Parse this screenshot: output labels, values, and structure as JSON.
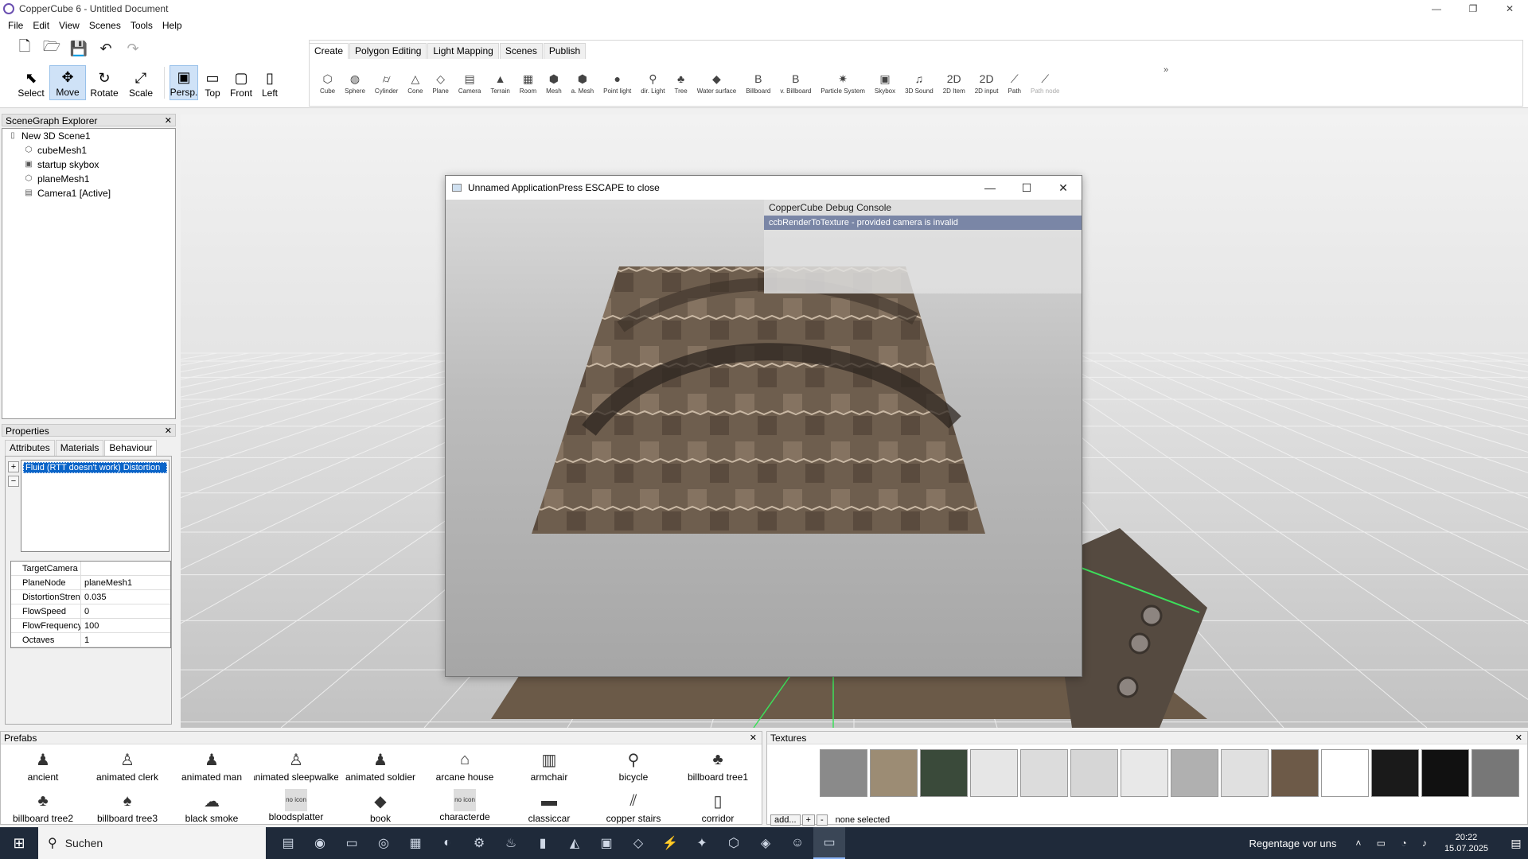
{
  "window": {
    "title": "CopperCube 6 - Untitled Document",
    "min": "—",
    "max": "❐",
    "close": "✕"
  },
  "menu": [
    "File",
    "Edit",
    "View",
    "Scenes",
    "Tools",
    "Help"
  ],
  "toolbar": {
    "file_icons": [
      "new-document-icon",
      "open-folder-icon",
      "save-icon",
      "undo-icon",
      "redo-icon"
    ],
    "tools": [
      {
        "label": "Select",
        "glyph": "⬉",
        "icon": "select-cursor-icon",
        "active": false
      },
      {
        "label": "Move",
        "glyph": "✥",
        "icon": "move-arrows-icon",
        "active": true
      },
      {
        "label": "Rotate",
        "glyph": "↻",
        "icon": "rotate-icon",
        "active": false
      },
      {
        "label": "Scale",
        "glyph": "⤢",
        "icon": "scale-icon",
        "active": false
      }
    ],
    "views": [
      {
        "label": "Persp.",
        "glyph": "▣",
        "icon": "perspective-view-icon",
        "active": true
      },
      {
        "label": "Top",
        "glyph": "▭",
        "icon": "top-view-icon",
        "active": false
      },
      {
        "label": "Front",
        "glyph": "▢",
        "icon": "front-view-icon",
        "active": false
      },
      {
        "label": "Left",
        "glyph": "▯",
        "icon": "left-view-icon",
        "active": false
      }
    ]
  },
  "tabs": [
    "Create",
    "Polygon Editing",
    "Light Mapping",
    "Scenes",
    "Publish"
  ],
  "create_items": [
    {
      "label": "Cube",
      "glyph": "⬡"
    },
    {
      "label": "Sphere",
      "glyph": "◍"
    },
    {
      "label": "Cylinder",
      "glyph": "⌭"
    },
    {
      "label": "Cone",
      "glyph": "△"
    },
    {
      "label": "Plane",
      "glyph": "◇"
    },
    {
      "label": "Camera",
      "glyph": "▤"
    },
    {
      "label": "Terrain",
      "glyph": "▲"
    },
    {
      "label": "Room",
      "glyph": "▦"
    },
    {
      "label": "Mesh",
      "glyph": "⬢"
    },
    {
      "label": "a. Mesh",
      "glyph": "⬢"
    },
    {
      "label": "Point light",
      "glyph": "●"
    },
    {
      "label": "dir. Light",
      "glyph": "⚲"
    },
    {
      "label": "Tree",
      "glyph": "♣"
    },
    {
      "label": "Water surface",
      "glyph": "◆"
    },
    {
      "label": "Billboard",
      "glyph": "B"
    },
    {
      "label": "v. Billboard",
      "glyph": "B"
    },
    {
      "label": "Particle System",
      "glyph": "✷"
    },
    {
      "label": "Skybox",
      "glyph": "▣"
    },
    {
      "label": "3D Sound",
      "glyph": "♫"
    },
    {
      "label": "2D Item",
      "glyph": "2D"
    },
    {
      "label": "2D input",
      "glyph": "2D"
    },
    {
      "label": "Path",
      "glyph": "⟋"
    },
    {
      "label": "Path node",
      "glyph": "⟋"
    }
  ],
  "create_more": "»",
  "scenegraph": {
    "title": "SceneGraph Explorer",
    "close": "✕",
    "items": [
      {
        "label": "New 3D Scene1",
        "icon": "scene-icon",
        "glyph": "▯",
        "indent": 0
      },
      {
        "label": "cubeMesh1",
        "icon": "mesh-icon",
        "glyph": "⬡",
        "indent": 1
      },
      {
        "label": "startup skybox",
        "icon": "skybox-icon",
        "glyph": "▣",
        "indent": 1
      },
      {
        "label": "planeMesh1",
        "icon": "mesh-icon",
        "glyph": "⬡",
        "indent": 1
      },
      {
        "label": "Camera1 [Active]",
        "icon": "camera-icon",
        "glyph": "▤",
        "indent": 1
      }
    ]
  },
  "properties": {
    "title": "Properties",
    "close": "✕",
    "tabs": [
      "Attributes",
      "Materials",
      "Behaviour"
    ],
    "add": "+",
    "remove": "−",
    "behaviours": [
      "Fluid (RTT doesn't work) Distortion"
    ],
    "attributes": [
      {
        "key": "TargetCamera",
        "value": ""
      },
      {
        "key": "PlaneNode",
        "value": "planeMesh1"
      },
      {
        "key": "DistortionStreng",
        "value": "0.035"
      },
      {
        "key": "FlowSpeed",
        "value": "0"
      },
      {
        "key": "FlowFrequency",
        "value": "100"
      },
      {
        "key": "Octaves",
        "value": "1"
      }
    ]
  },
  "player": {
    "title": "Unnamed ApplicationPress ESCAPE to close",
    "min": "—",
    "max": "☐",
    "close": "✕",
    "debug_title": "CopperCube Debug Console",
    "debug_lines": [
      "ccbRenderToTexture - provided camera is invalid"
    ]
  },
  "prefabs": {
    "title": "Prefabs",
    "close": "✕",
    "items": [
      {
        "label": "ancient",
        "glyph": "♟"
      },
      {
        "label": "animated clerk",
        "glyph": "♙"
      },
      {
        "label": "animated man",
        "glyph": "♟"
      },
      {
        "label": "animated sleepwalker",
        "glyph": "♙"
      },
      {
        "label": "animated soldier",
        "glyph": "♟"
      },
      {
        "label": "arcane house",
        "glyph": "⌂"
      },
      {
        "label": "armchair",
        "glyph": "▥"
      },
      {
        "label": "bicycle",
        "glyph": "⚲"
      },
      {
        "label": "billboard tree1",
        "glyph": "♣"
      },
      {
        "label": "billboard tree2",
        "glyph": "♣"
      },
      {
        "label": "billboard tree3",
        "glyph": "♠"
      },
      {
        "label": "black smoke",
        "glyph": "☁"
      },
      {
        "label": "bloodsplatter",
        "glyph": "no icon",
        "noicon": true
      },
      {
        "label": "book",
        "glyph": "◆"
      },
      {
        "label": "characterde",
        "glyph": "no icon",
        "noicon": true
      },
      {
        "label": "classiccar",
        "glyph": "▬"
      },
      {
        "label": "copper stairs",
        "glyph": "⫽"
      },
      {
        "label": "corridor",
        "glyph": "▯"
      }
    ]
  },
  "textures": {
    "title": "Textures",
    "close": "✕",
    "add": "add...",
    "plus": "+",
    "minus": "-",
    "status": "none selected",
    "swatches": [
      "#8a8a8a",
      "#9c8c74",
      "#3a4a3a",
      "#e6e6e6",
      "#dcdcdc",
      "#d6d6d6",
      "#e8e8e8",
      "#b0b0b0",
      "#e0e0e0",
      "#6d5a48",
      "#ffffff",
      "#1a1a1a",
      "#111111",
      "#777777"
    ]
  },
  "taskbar": {
    "search_placeholder": "Suchen",
    "weather": "Regentage vor uns",
    "time": "20:22",
    "date": "15.07.2025",
    "apps": [
      "task-view-icon",
      "edge-icon",
      "explorer-icon",
      "media-icon",
      "printer-icon",
      "app-icon",
      "app-icon",
      "duck-icon",
      "terminal-icon",
      "app-icon",
      "app-icon",
      "app-icon",
      "app-icon",
      "app-icon",
      "app-icon",
      "app-icon",
      "discord-icon",
      "active-window-icon"
    ]
  }
}
